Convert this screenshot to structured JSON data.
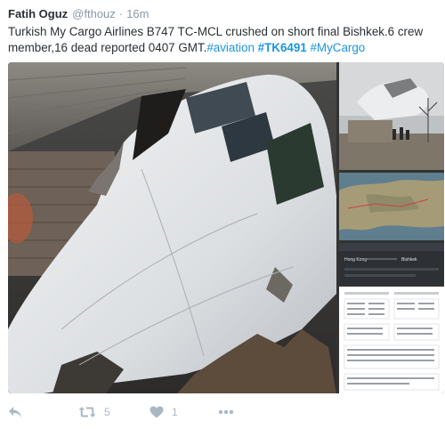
{
  "tweet": {
    "author_name": "Fatih Oguz",
    "handle": "@fthouz",
    "separator": "·",
    "timestamp": "16m",
    "text_plain": "Turkish My Cargo Airlines B747 TC-MCL crushed on short final Bishkek.6 crew member,16 dead reported 0407 GMT.",
    "hashtags": [
      "#aviation",
      "#TK6491",
      "#MyCargo"
    ],
    "media": {
      "main_photo": "plane-wreckage-cockpit-photo",
      "thumb1": "crash-site-photo",
      "thumb2": "flight-map-photo",
      "thumb3": "flight-tracker-screenshot",
      "thumb4": "flight-data-table-screenshot"
    },
    "actions": {
      "reply_icon": "reply-icon",
      "retweet_icon": "retweet-icon",
      "retweet_count": "5",
      "like_icon": "heart-icon",
      "like_count": "1",
      "more_icon": "more-icon"
    },
    "colors": {
      "link": "#1b95e0",
      "text": "#292f33",
      "muted": "#8899a6",
      "action": "#aab8c2"
    }
  },
  "thumb3_text": {
    "origin": "Hong Kong",
    "destination": "Bishkek"
  }
}
